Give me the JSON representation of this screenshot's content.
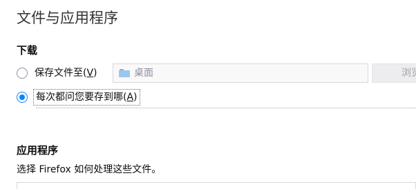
{
  "page": {
    "title": "文件与应用程序"
  },
  "downloads": {
    "heading": "下载",
    "save_option": {
      "label": "保存文件至",
      "access_key": "V",
      "selected": false
    },
    "folder": {
      "icon": "folder-icon",
      "name": "桌面"
    },
    "browse_label": "浏览",
    "ask_option": {
      "label": "每次都问您要存到哪",
      "access_key": "A",
      "selected": true
    }
  },
  "applications": {
    "heading": "应用程序",
    "description": "选择 Firefox 如何处理这些文件。"
  },
  "colors": {
    "accent": "#0a84ff",
    "field_background": "#f9f9fa",
    "button_background": "#ededf0"
  }
}
